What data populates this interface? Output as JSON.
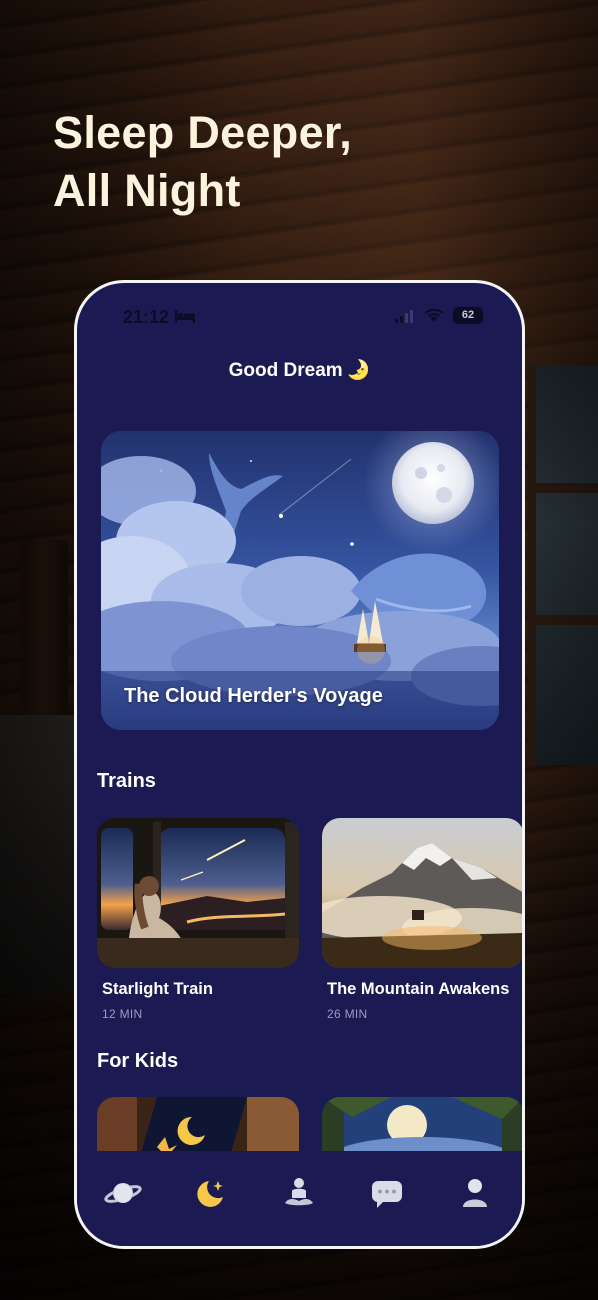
{
  "headline": {
    "line1": "Sleep Deeper,",
    "line2": "All Night"
  },
  "status_bar": {
    "time": "21:12",
    "battery": "62"
  },
  "app": {
    "title": "Good Dream",
    "title_emoji": "🌛"
  },
  "hero": {
    "title": "The Cloud Herder's Voyage"
  },
  "sections": {
    "trains": {
      "title": "Trains",
      "items": [
        {
          "title": "Starlight Train",
          "duration": "12 MIN"
        },
        {
          "title": "The Mountain Awakens",
          "duration": "26 MIN"
        }
      ]
    },
    "kids": {
      "title": "For Kids"
    }
  },
  "tabbar": {
    "tabs": [
      {
        "icon": "planet-icon",
        "active": false
      },
      {
        "icon": "moon-star-icon",
        "active": true
      },
      {
        "icon": "meditation-icon",
        "active": false
      },
      {
        "icon": "chat-bubble-icon",
        "active": false
      },
      {
        "icon": "profile-icon",
        "active": false
      }
    ]
  },
  "colors": {
    "app_background": "#1c1a52",
    "headline": "#fbf3dd",
    "accent_moon": "#f6c84a",
    "secondary_text": "#9b9bc4"
  }
}
